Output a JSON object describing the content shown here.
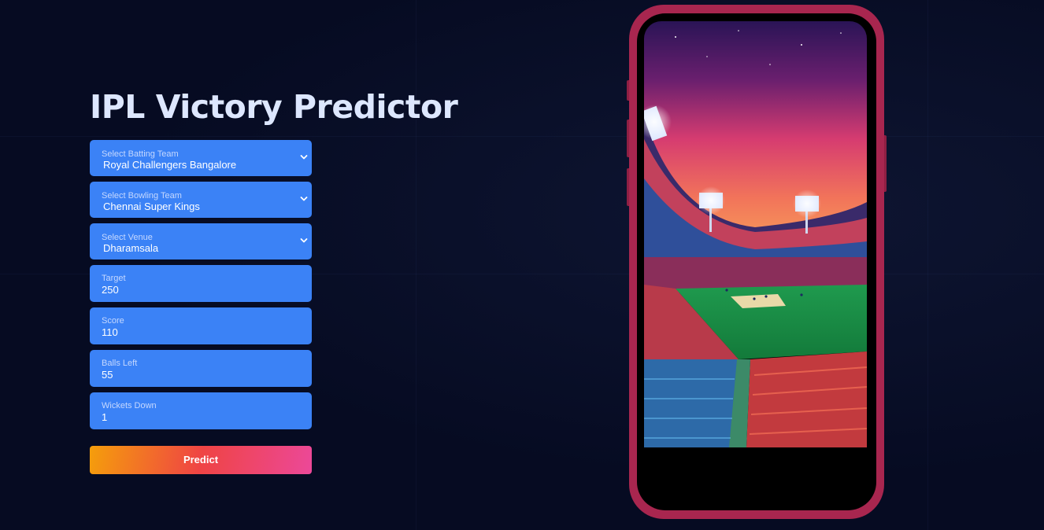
{
  "app": {
    "title": "IPL Victory Predictor"
  },
  "form": {
    "batting_team": {
      "label": "Select Batting Team",
      "value": "Royal Challengers Bangalore"
    },
    "bowling_team": {
      "label": "Select Bowling Team",
      "value": "Chennai Super Kings"
    },
    "venue": {
      "label": "Select Venue",
      "value": "Dharamsala"
    },
    "target": {
      "label": "Target",
      "value": "250"
    },
    "score": {
      "label": "Score",
      "value": "110"
    },
    "balls_left": {
      "label": "Balls Left",
      "value": "55"
    },
    "wickets_down": {
      "label": "Wickets Down",
      "value": "1"
    },
    "predict_label": "Predict"
  },
  "colors": {
    "background": "#060b22",
    "field": "#3b82f6",
    "title": "#dde7ff",
    "phone_frame": "#a8264f",
    "button_gradient": [
      "#f59e0b",
      "#ef4444",
      "#ec4899"
    ]
  },
  "icons": {
    "select_indicator": "chevron-down-icon"
  }
}
